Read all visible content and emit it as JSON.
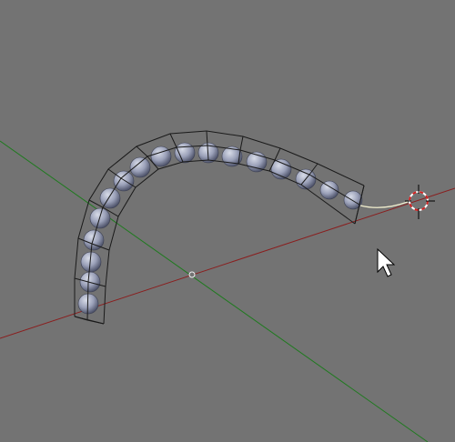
{
  "viewport": {
    "name": "3d-viewport",
    "background_color": "#737373"
  },
  "colors": {
    "x_axis": "#8a1e1e",
    "y_axis": "#1f7a1f",
    "wire": "#1a1a1a",
    "sphere_light": "#d8dce8",
    "sphere_mid": "#9aa0b8",
    "sphere_dark": "#4a4f66",
    "curve_tail": "#f2efcf",
    "cursor_red": "#d02020",
    "cursor_white": "#ffffff",
    "mouse_fill": "#ffffff",
    "mouse_stroke": "#000000"
  },
  "icons": {
    "three_d_cursor": "3d-cursor-icon",
    "mouse_pointer": "mouse-pointer-icon",
    "origin": "world-origin-icon"
  }
}
